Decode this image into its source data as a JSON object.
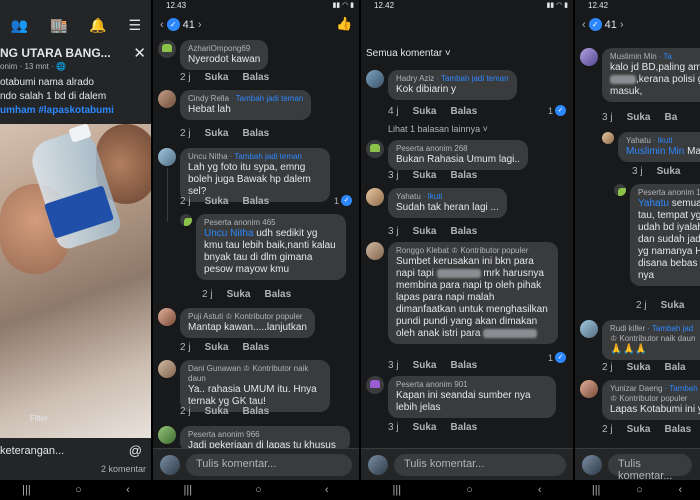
{
  "panel1": {
    "post_title": "NG UTARA BANG...",
    "close_glyph": "✕",
    "post_sub": "onim · 13 mnt · ",
    "post_lines": [
      "otabumi nama alrado",
      "ndo salah 1 bd di dalem"
    ],
    "post_tags": "umham #lapaskotabumi",
    "filter_label": "Filter",
    "composer_placeholder": "keterangan...",
    "composer_at": "@",
    "comment_count": "2 komentar",
    "nav": [
      "|||",
      "○",
      "‹"
    ]
  },
  "panel2": {
    "status_time": "12.43",
    "likes_count": "41",
    "comments": [
      {
        "name": "AzhariOmpong69",
        "follow": "",
        "badge": "",
        "text": "Nyerodot kawan",
        "time": "2 j",
        "like": "Suka",
        "reply": "Balas",
        "reactions": ""
      },
      {
        "name": "Cindy Rella",
        "follow": "· Tambah jadi teman",
        "badge": "",
        "text": "Hebat lah",
        "time": "2 j",
        "like": "Suka",
        "reply": "Balas",
        "reactions": ""
      },
      {
        "name": "Uncu Nitha",
        "follow": "· Tambah jadi teman",
        "badge": "",
        "text": "Lah yg foto itu sypa, emng boleh juga Bawak hp dalem sel?",
        "time": "2 j",
        "like": "Suka",
        "reply": "Balas",
        "reactions": "1"
      },
      {
        "name": "Peserta anonim 465",
        "follow": "",
        "badge": "",
        "mention": "Uncu Nitha",
        "text": " udh sedikit yg kmu tau lebih baik,nanti kalau bnyak tau di dlm gimana pesow mayow kmu",
        "time": "2 j",
        "like": "Suka",
        "reply": "Balas",
        "reactions": ""
      },
      {
        "name": "Puji Astuti",
        "follow": "",
        "badge": "♔ Kontributor populer",
        "text": "Mantap kawan.....lanjutkan",
        "time": "2 j",
        "like": "Suka",
        "reply": "Balas",
        "reactions": ""
      },
      {
        "name": "Dani Gunawan",
        "follow": "",
        "badge": "♔ Kontributor naik daun",
        "text": "Ya.. rahasia UMUM itu. Hnya ternak yg GK tau!",
        "time": "2 j",
        "like": "Suka",
        "reply": "Balas",
        "reactions": ""
      },
      {
        "name": "Peserta anonim 966",
        "follow": "",
        "badge": "",
        "text": "Jadi pekerjaan di lapas tu khusus",
        "time": "",
        "like": "",
        "reply": "",
        "reactions": ""
      }
    ],
    "composer_placeholder": "Tulis komentar...",
    "nav": [
      "|||",
      "○",
      "‹"
    ]
  },
  "panel3": {
    "status_time": "12.42",
    "sorter": "Semua komentar ˅",
    "comments": [
      {
        "name": "Hadry Aziz",
        "follow": "· Tambah jadi teman",
        "badge": "",
        "text": "Kok dibiarin y",
        "time": "4 j",
        "like": "Suka",
        "reply": "Balas",
        "reactions": "1"
      },
      {
        "name": "Peserta anonim 268",
        "follow": "",
        "badge": "",
        "text": "Bukan Rahasia Umum lagi..",
        "time": "3 j",
        "like": "Suka",
        "reply": "Balas",
        "reactions": ""
      },
      {
        "name": "Yahatu",
        "follow": "· Ikuti",
        "badge": "",
        "text": "Sudah tak heran lagi ...",
        "time": "3 j",
        "like": "Suka",
        "reply": "Balas",
        "reactions": ""
      },
      {
        "name": "Ronggo Klebat",
        "follow": "",
        "badge": "♔ Kontributor populer",
        "text_a": "Sumbet kerusakan ini bkn para napi tapi",
        "text_b": "mrk harusnya membina para napi tp oleh pihak lapas para napi malah dimanfaatkan untuk menghasilkan pundi pundi yang akan dimakan oleh anak istri para",
        "time": "3 j",
        "like": "Suka",
        "reply": "Balas",
        "reactions": "1"
      },
      {
        "name": "Peserta anonim 901",
        "follow": "",
        "badge": "",
        "text": "Kapan ini seandai sumber nya lebih jelas",
        "time": "3 j",
        "like": "Suka",
        "reply": "Balas",
        "reactions": ""
      }
    ],
    "view_replies": "Lihat 1 balasan lainnya ˅",
    "composer_placeholder": "Tulis komentar...",
    "nav": [
      "|||",
      "○",
      "‹"
    ]
  },
  "panel4": {
    "status_time": "12.42",
    "likes_count": "41",
    "comments": [
      {
        "name": "Muslimin Min",
        "follow": "· Ta",
        "badge": "",
        "text_a": "kalo jd BD,paling amar",
        "text_b": ",kerana polisi gk",
        "text_c": "masuk,",
        "time": "3 j",
        "like": "Suka",
        "reply": "Ba"
      },
      {
        "name": "Yahatu",
        "follow": "· Ikuti",
        "mention": "Muslimin Min",
        "text": " Mas",
        "time": "3 j",
        "like": "Suka",
        "reply": ""
      },
      {
        "name": "Peserta anonim 17",
        "mention": "Yahatu",
        "text": " semua tau, tempat yg udah bd iyalah dan sudah jadi yg namanya HP disana bebas ap nya",
        "time": "2 j",
        "like": "Suka",
        "reply": ""
      },
      {
        "name": "Rudi killer",
        "follow": "· Tambah jad",
        "badge": "♔ Kontributor naik daun",
        "text": "🙏🙏🙏",
        "time": "2 j",
        "like": "Suka",
        "reply": "Bala"
      },
      {
        "name": "Yunizar Daeng",
        "follow": "· Tambah",
        "badge": "♔ Kontributor populer",
        "text": "Lapas Kotabumi ini ya",
        "time": "2 j",
        "like": "Suka",
        "reply": "Balas"
      }
    ],
    "composer_placeholder": "Tulis komentar...",
    "nav": [
      "|||",
      "○",
      "‹"
    ]
  },
  "icons": {
    "thumb": "👍",
    "like_badge": "👍"
  }
}
